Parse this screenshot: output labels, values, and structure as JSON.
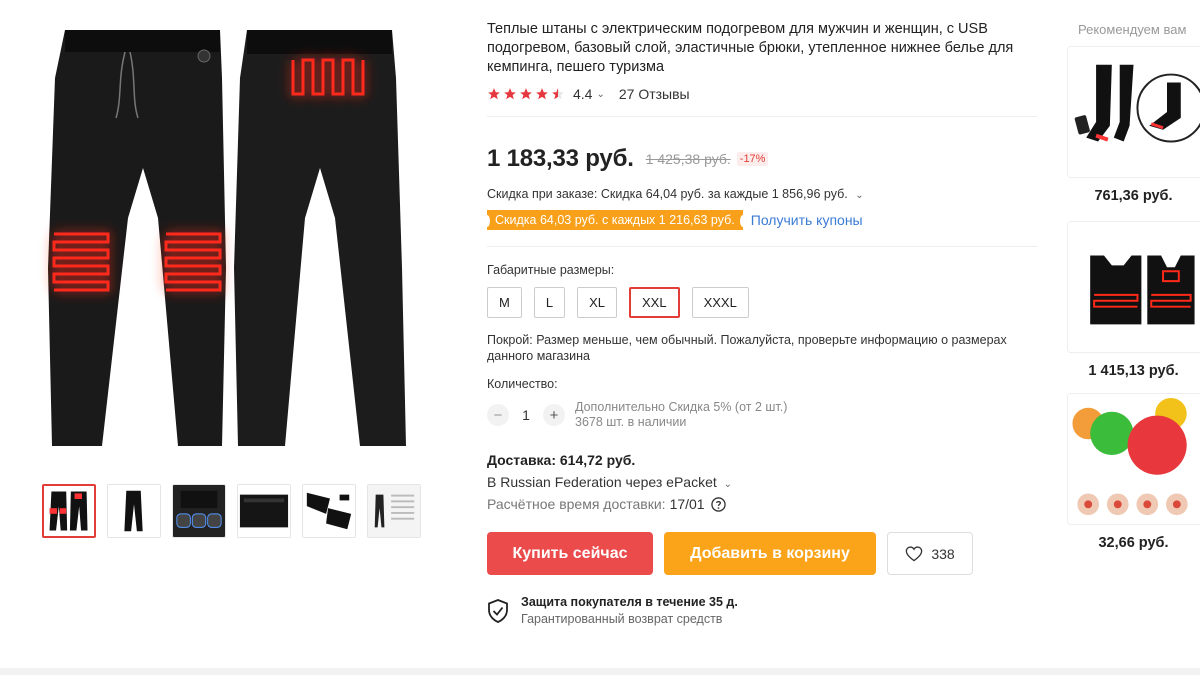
{
  "product": {
    "title": "Теплые штаны с электрическим подогревом для мужчин и женщин, с USB подогревом, базовый слой, эластичные брюки, утепленное нижнее белье для кемпинга, пешего туризма",
    "rating": "4.4",
    "rating_stars_fraction": 0.88,
    "reviews": "27 Отзывы",
    "price": "1 183,33 руб.",
    "old_price": "1 425,38 руб.",
    "discount": "-17%",
    "order_discount": "Скидка при заказе: Скидка 64,04 руб. за каждые 1 856,96 руб.",
    "coupon_badge": "Скидка 64,03 руб. с каждых 1 216,63 руб.",
    "coupon_link": "Получить купоны",
    "sizes_label": "Габаритные размеры:",
    "sizes": [
      "M",
      "L",
      "XL",
      "XXL",
      "XXXL"
    ],
    "selected_size": "XXL",
    "fit_note": "Покрой: Размер меньше, чем обычный. Пожалуйста, проверьте информацию о размерах данного магазина",
    "quantity_label": "Количество:",
    "quantity": "1",
    "qty_extra_discount": "Дополнительно Скидка 5% (от 2 шт.)",
    "qty_stock": "3678 шт. в наличии",
    "delivery_price": "Доставка: 614,72 руб.",
    "delivery_route": "В Russian Federation через ePacket",
    "delivery_time_label": "Расчётное время доставки:",
    "delivery_time_value": "17/01",
    "buy_now": "Купить сейчас",
    "add_to_cart": "Добавить в корзину",
    "wishlist_count": "338",
    "protection_title": "Защита покупателя в течение 35 д.",
    "protection_sub": "Гарантированный возврат средств"
  },
  "recommendations": {
    "title": "Рекомендуем вам",
    "items": [
      {
        "price": "761,36 руб."
      },
      {
        "price": "1 415,13 руб."
      },
      {
        "price": "32,66 руб."
      }
    ]
  },
  "colors": {
    "accent_red": "#e23d36",
    "buy_button": "#eb4b4b",
    "cart_button": "#fba319",
    "coupon": "#f8a01a",
    "link": "#3a7bd5"
  }
}
